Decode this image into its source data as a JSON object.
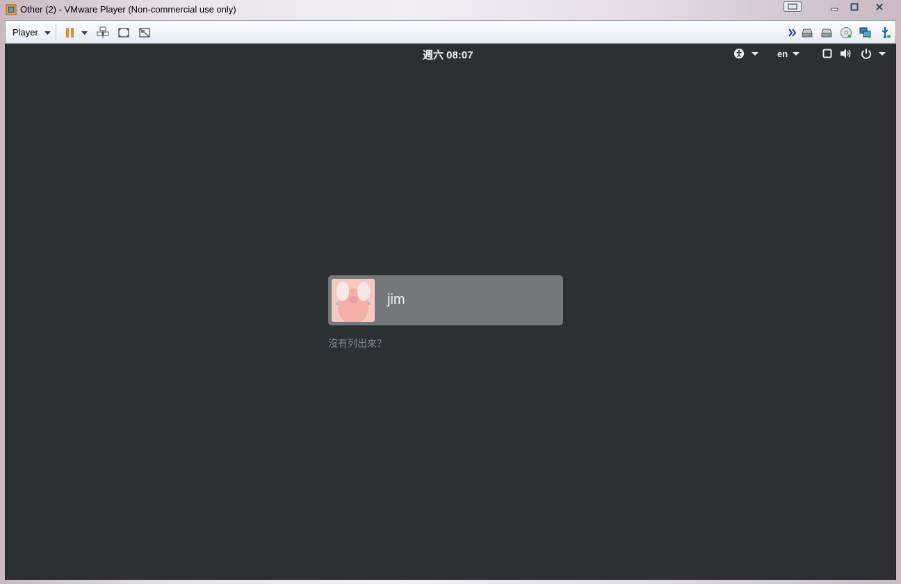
{
  "window": {
    "title": "Other (2) - VMware Player (Non-commercial use only)"
  },
  "toolbar": {
    "player_menu_label": "Player",
    "icons": [
      "pause-icon",
      "send-ctrl-alt-del-icon",
      "full-screen-icon",
      "unity-icon",
      "more-devices-icon",
      "hard-disk-icon",
      "hard-disk-2-icon",
      "cd-dvd-icon",
      "network-adapter-icon",
      "usb-device-icon"
    ]
  },
  "gnome": {
    "clock": "週六 08:07",
    "input_source": "en",
    "tray_icons": [
      "accessibility-icon",
      "input-source-menu",
      "screen-icon",
      "volume-icon",
      "power-icon"
    ]
  },
  "login": {
    "username": "jim",
    "not_listed": "沒有列出來？"
  },
  "colors": {
    "screen_bg": "#2c3033",
    "user_card_bg": "#75787a",
    "pause_accent": "#e8872d"
  }
}
